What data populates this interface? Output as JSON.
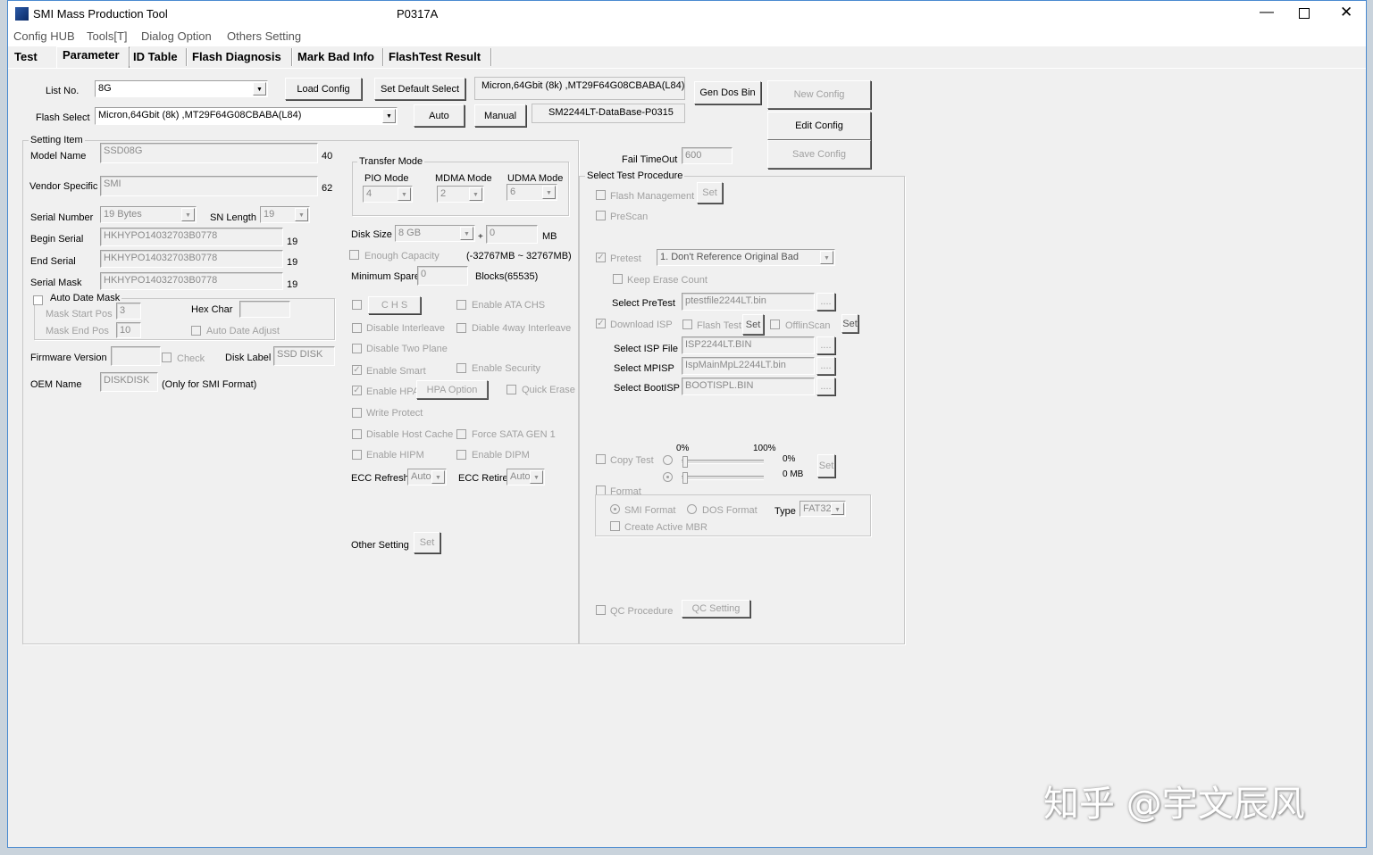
{
  "window": {
    "title": "SMI Mass Production Tool",
    "version": "P0317A"
  },
  "menu": [
    "Config HUB",
    "Tools[T]",
    "Dialog Option",
    "Others Setting"
  ],
  "tabs": [
    "Test",
    "Parameter",
    "ID Table",
    "Flash Diagnosis",
    "Mark Bad Info",
    "FlashTest Result"
  ],
  "top": {
    "list_no_label": "List No.",
    "list_no": "8G",
    "load_config": "Load Config",
    "set_default": "Set Default Select",
    "flash_info": "Micron,64Gbit (8k) ,MT29F64G08CBABA(L84)",
    "gen_dos_bin": "Gen Dos Bin",
    "new_config": "New Config",
    "edit_config": "Edit Config",
    "save_config": "Save Config",
    "flash_select_label": "Flash Select",
    "flash_select": "Micron,64Gbit (8k) ,MT29F64G08CBABA(L84)",
    "auto": "Auto",
    "manual": "Manual",
    "database": "SM2244LT-DataBase-P0315",
    "fail_timeout_label": "Fail TimeOut",
    "fail_timeout": "600"
  },
  "setting": {
    "legend": "Setting Item",
    "model_name_label": "Model Name",
    "model_name": "SSD08G",
    "model_len": "40",
    "vendor_label": "Vendor Specific",
    "vendor": "SMI",
    "vendor_len": "62",
    "serial_number_label": "Serial Number",
    "serial_number": "19 Bytes",
    "sn_length_label": "SN Length",
    "sn_length": "19",
    "begin_serial_label": "Begin Serial",
    "begin_serial": "HKHYPO14032703B0778",
    "begin_len": "19",
    "end_serial_label": "End Serial",
    "end_serial": "HKHYPO14032703B0778",
    "end_len": "19",
    "serial_mask_label": "Serial Mask",
    "serial_mask": "HKHYPO14032703B0778",
    "mask_len": "19",
    "auto_date_mask": "Auto Date Mask",
    "mask_start_label": "Mask Start Pos",
    "mask_start": "3",
    "hex_char_label": "Hex Char",
    "hex_char": "",
    "mask_end_label": "Mask End Pos",
    "mask_end": "10",
    "auto_date_adjust": "Auto Date Adjust",
    "fw_label": "Firmware Version",
    "fw": "",
    "check": "Check",
    "disk_label_label": "Disk Label",
    "disk_label": "SSD DISK",
    "oem_label": "OEM Name",
    "oem": "DISKDISK",
    "oem_note": "(Only for SMI Format)"
  },
  "mid": {
    "transfer_mode": "Transfer Mode",
    "pio_label": "PIO Mode",
    "pio": "4",
    "mdma_label": "MDMA Mode",
    "mdma": "2",
    "udma_label": "UDMA Mode",
    "udma": "6",
    "disk_size_label": "Disk Size",
    "disk_size": "8 GB",
    "plus": "+",
    "disk_extra": "0",
    "mb": "MB",
    "enough_capacity": "Enough Capacity",
    "range": "(-32767MB ~ 32767MB)",
    "min_spare_label": "Minimum Spare",
    "min_spare": "0",
    "blocks": "Blocks(65535)",
    "chs": "C H S",
    "ata_chs": "Enable ATA CHS",
    "disable_interleave": "Disable Interleave",
    "diable_4way": "Diable 4way Interleave",
    "disable_two_plane": "Disable Two Plane",
    "enable_smart": "Enable Smart",
    "enable_security": "Enable Security",
    "enable_hpa": "Enable HPA",
    "hpa_option": "HPA Option",
    "quick_erase": "Quick Erase",
    "write_protect": "Write Protect",
    "disable_host_cache": "Disable Host Cache",
    "force_sata": "Force SATA GEN 1",
    "enable_hipm": "Enable HIPM",
    "enable_dipm": "Enable DIPM",
    "ecc_refresh_label": "ECC Refresh",
    "ecc_refresh": "Auto",
    "ecc_retire_label": "ECC Retire",
    "ecc_retire": "Auto",
    "other_setting": "Other Setting",
    "set": "Set"
  },
  "proc": {
    "legend": "Select Test Procedure",
    "flash_management": "Flash Management",
    "set": "Set",
    "prescan": "PreScan",
    "pretest": "Pretest",
    "pretest_option": "1. Don't Reference Original Bad",
    "keep_erase": "Keep Erase Count",
    "select_pretest": "Select PreTest",
    "pretest_file": "ptestfile2244LT.bin",
    "browse": "....",
    "download_isp": "Download ISP",
    "flash_test": "Flash Test",
    "offlinscan": "OfflinScan",
    "isp_label": "Select ISP File",
    "isp": "ISP2244LT.BIN",
    "mpisp_label": "Select MPISP",
    "mpisp": "IspMainMpL2244LT.bin",
    "bootisp_label": "Select BootISP",
    "bootisp": "BOOTISPL.BIN",
    "copy_test": "Copy Test",
    "pct_min": "0%",
    "pct_max": "100%",
    "copy_pct": "0%",
    "copy_mb": "0 MB",
    "copy_pct_value": 0,
    "format": "Format",
    "smi_format": "SMI Format",
    "dos_format": "DOS Format",
    "type_label": "Type",
    "type": "FAT32",
    "create_mbr": "Create Active MBR",
    "qc_procedure": "QC Procedure",
    "qc_setting": "QC Setting"
  },
  "watermark": "知乎 @宇文辰风"
}
